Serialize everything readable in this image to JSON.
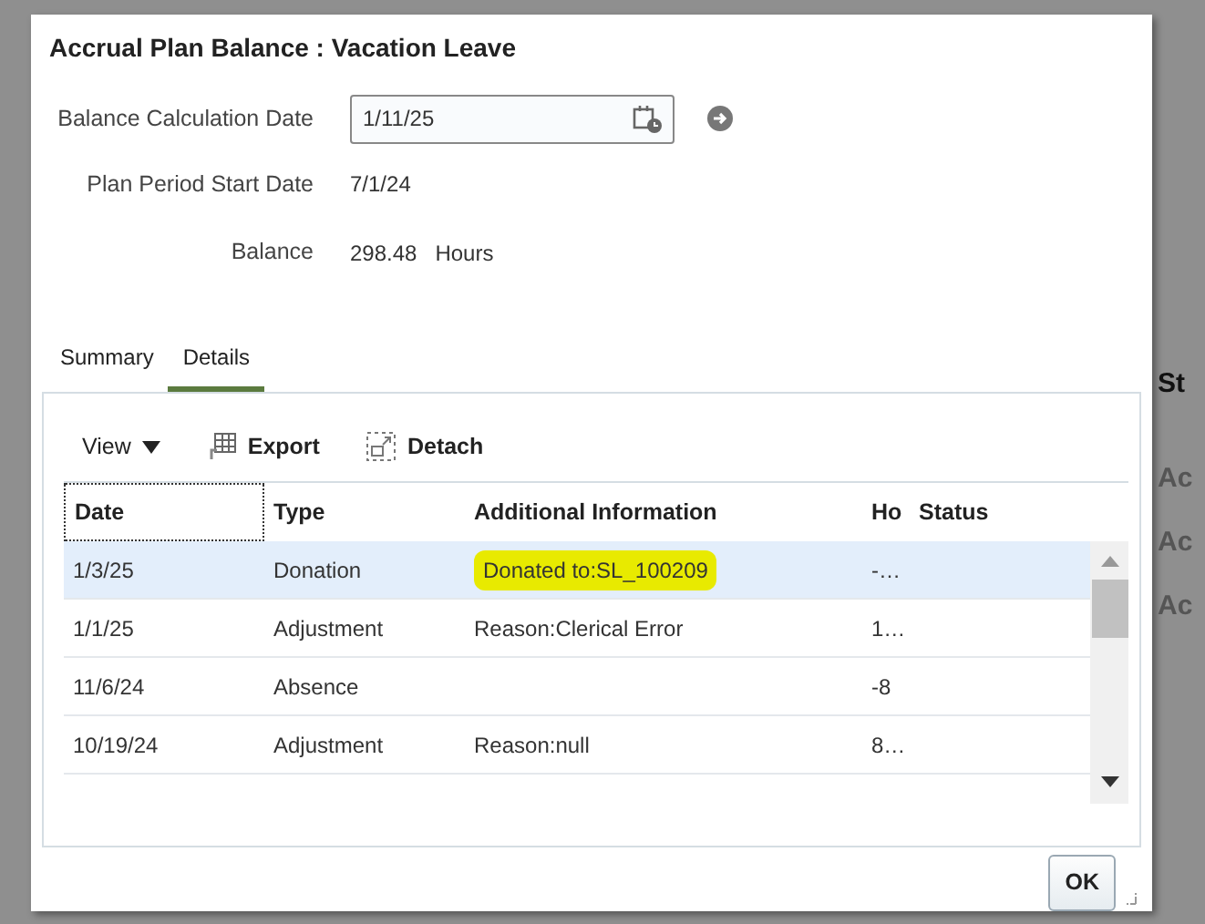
{
  "background": {
    "column_header": "St",
    "rows": [
      "Ac",
      "Ac",
      "Ac"
    ]
  },
  "dialog": {
    "title": "Accrual Plan Balance : Vacation Leave",
    "fields": [
      {
        "label": "Balance Calculation Date",
        "kind": "date-input",
        "value": "1/11/25"
      },
      {
        "label": "Plan Period Start Date",
        "kind": "text",
        "value": "7/1/24"
      },
      {
        "label": "Balance",
        "kind": "text",
        "value": "298.48",
        "unit": "Hours"
      }
    ],
    "tabs": [
      {
        "label": "Summary",
        "selected": false
      },
      {
        "label": "Details",
        "selected": true
      }
    ],
    "toolbar": [
      {
        "label": "View",
        "kind": "menu"
      },
      {
        "label": "Export",
        "kind": "export"
      },
      {
        "label": "Detach",
        "kind": "detach"
      }
    ],
    "table": {
      "columns": [
        "Date",
        "Type",
        "Additional Information",
        "Ho",
        "Status"
      ],
      "rows": [
        {
          "cells": [
            "1/3/25",
            "Donation",
            "Donated to:SL_100209",
            "-…",
            ""
          ],
          "selected": true,
          "highlighted": true
        },
        {
          "cells": [
            "1/1/25",
            "Adjustment",
            "Reason:Clerical Error",
            "1…",
            ""
          ],
          "selected": false,
          "highlighted": false
        },
        {
          "cells": [
            "11/6/24",
            "Absence",
            "",
            "-8",
            ""
          ],
          "selected": false
        },
        {
          "cells": [
            "10/19/24",
            "Adjustment",
            "Reason:null",
            "8…",
            ""
          ],
          "selected": false,
          "highlighted": false
        }
      ]
    },
    "ok_button": "OK"
  }
}
